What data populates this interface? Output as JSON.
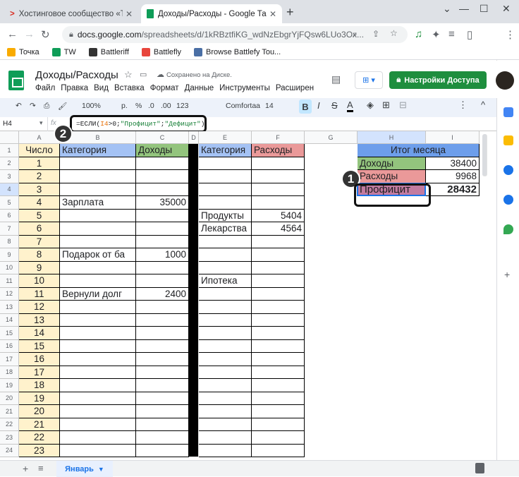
{
  "browser": {
    "tabs": [
      {
        "title": "Хостинговое сообщество «Time",
        "active": false
      },
      {
        "title": "Доходы/Расходы - Google Табл",
        "active": true
      }
    ],
    "url_main": "docs.google.com",
    "url_path": "/spreadsheets/d/1kRBztfiKG_wdNzEbgrYjFQsw6LUo3Ox...",
    "bookmarks": [
      "Точка",
      "TW",
      "Battleriff",
      "Battlefly",
      "Browse Battlefy Tou..."
    ]
  },
  "sheets": {
    "doc_title": "Доходы/Расходы",
    "save_status": "Сохранено на Диске.",
    "menu": [
      "Файл",
      "Правка",
      "Вид",
      "Вставка",
      "Формат",
      "Данные",
      "Инструменты",
      "Расширен"
    ],
    "share_label": "Настройки Доступа",
    "toolbar": {
      "zoom": "100%",
      "currency": "р.",
      "percent": "%",
      "dec_less": ".0",
      "dec_more": ".00",
      "more_formats": "123",
      "font": "Comfortaa",
      "font_size": "14",
      "bold": "B",
      "italic": "I",
      "strike": "S",
      "text_color": "A"
    },
    "name_box": "H4",
    "fx": "fx",
    "formula": {
      "prefix": "=ЕСЛИ(",
      "ref": "I4",
      "op": ">0;",
      "s1": "\"Профицит\"",
      "sep": ";",
      "s2": "\"Дефицит\"",
      "suffix": ")"
    },
    "columns": [
      "A",
      "B",
      "C",
      "D",
      "E",
      "F",
      "G",
      "H",
      "I"
    ],
    "rows": [
      "1",
      "2",
      "3",
      "4",
      "5",
      "6",
      "7",
      "8",
      "9",
      "10",
      "11",
      "12",
      "13",
      "14",
      "15",
      "16",
      "17",
      "18",
      "19",
      "20",
      "21",
      "22",
      "23",
      "24"
    ],
    "header_cells": {
      "A1": "Число",
      "B1": "Категория",
      "C1": "Доходы",
      "E1": "Категория",
      "F1": "Расходы",
      "H1": "Итог месяца"
    },
    "numbers_A": [
      "1",
      "2",
      "3",
      "4",
      "5",
      "6",
      "7",
      "8",
      "9",
      "10",
      "11",
      "12",
      "13",
      "14",
      "15",
      "16",
      "17",
      "18",
      "19",
      "20",
      "21",
      "22",
      "23"
    ],
    "income": [
      {
        "row": 5,
        "category": "Зарплата",
        "amount": "35000"
      },
      {
        "row": 9,
        "category": "Подарок от ба",
        "amount": "1000"
      },
      {
        "row": 12,
        "category": "Вернули долг",
        "amount": "2400"
      }
    ],
    "expenses": [
      {
        "row": 6,
        "category": "Продукты",
        "amount": "5404"
      },
      {
        "row": 7,
        "category": "Лекарства",
        "amount": "4564"
      },
      {
        "row": 11,
        "category": "Ипотека",
        "amount": ""
      }
    ],
    "summary": [
      {
        "label": "Доходы",
        "value": "38400"
      },
      {
        "label": "Расходы",
        "value": "9968"
      },
      {
        "label": "Профицит",
        "value": "28432"
      }
    ],
    "sheet_tab": "Январь",
    "annotations": [
      "1",
      "2"
    ]
  },
  "colors": {
    "sheets_green": "#0f9d58",
    "share_green": "#1e8e3e",
    "col_a_fill": "#fff2cc",
    "income_header": "#a4c2f4",
    "inc_col_fill": "#93c47d",
    "exp_header": "#ea9999",
    "summary_header": "#6d9eeb",
    "surplus_fill": "#c27ba0"
  }
}
